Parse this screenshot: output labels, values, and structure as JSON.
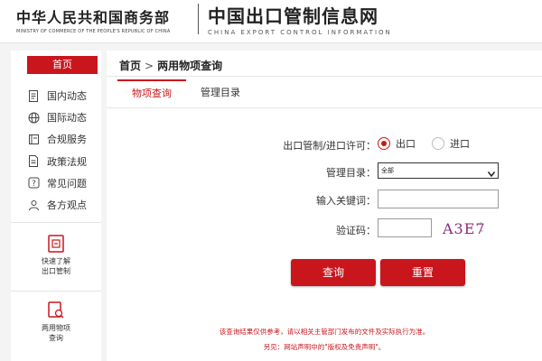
{
  "header": {
    "mofcom_cn": "中华人民共和国商务部",
    "mofcom_en": "MINISTRY OF COMMERCE OF THE PEOPLE'S REPUBLIC OF CHINA",
    "site_cn": "中国出口管制信息网",
    "site_en": "CHINA EXPORT CONTROL INFORMATION"
  },
  "sidebar": {
    "home": "首页",
    "items": [
      {
        "label": "国内动态",
        "icon": "document-icon"
      },
      {
        "label": "国际动态",
        "icon": "globe-icon"
      },
      {
        "label": "合规服务",
        "icon": "book-icon"
      },
      {
        "label": "政策法规",
        "icon": "file-icon"
      },
      {
        "label": "常见问题",
        "icon": "question-icon"
      },
      {
        "label": "各方观点",
        "icon": "people-icon"
      }
    ],
    "quick_links": [
      {
        "line1": "快速了解",
        "line2": "出口管制",
        "icon": "export-control-icon"
      },
      {
        "line1": "两用物项",
        "line2": "查询",
        "icon": "item-search-icon"
      }
    ]
  },
  "breadcrumb": {
    "home": "首页",
    "sep": ">",
    "current": "两用物项查询"
  },
  "tabs": [
    {
      "label": "物项查询",
      "active": true
    },
    {
      "label": "管理目录",
      "active": false
    }
  ],
  "form": {
    "license_label": "出口管制/进口许可：",
    "options": [
      {
        "label": "出口",
        "checked": true
      },
      {
        "label": "进口",
        "checked": false
      }
    ],
    "catalog_label": "管理目录：",
    "catalog_value": "全部",
    "keyword_label": "输入关键词：",
    "keyword_value": "",
    "captcha_label": "验证码：",
    "captcha_value": "",
    "captcha_text": "A3E7",
    "query_button": "查询",
    "reset_button": "重置"
  },
  "notes": {
    "line1": "该查询结果仅供参考，请以相关主管部门发布的文件及实际执行为准。",
    "line2": "另见：网站声明中的\"版权及免责声明\"。"
  },
  "colors": {
    "accent": "#c9161d"
  }
}
